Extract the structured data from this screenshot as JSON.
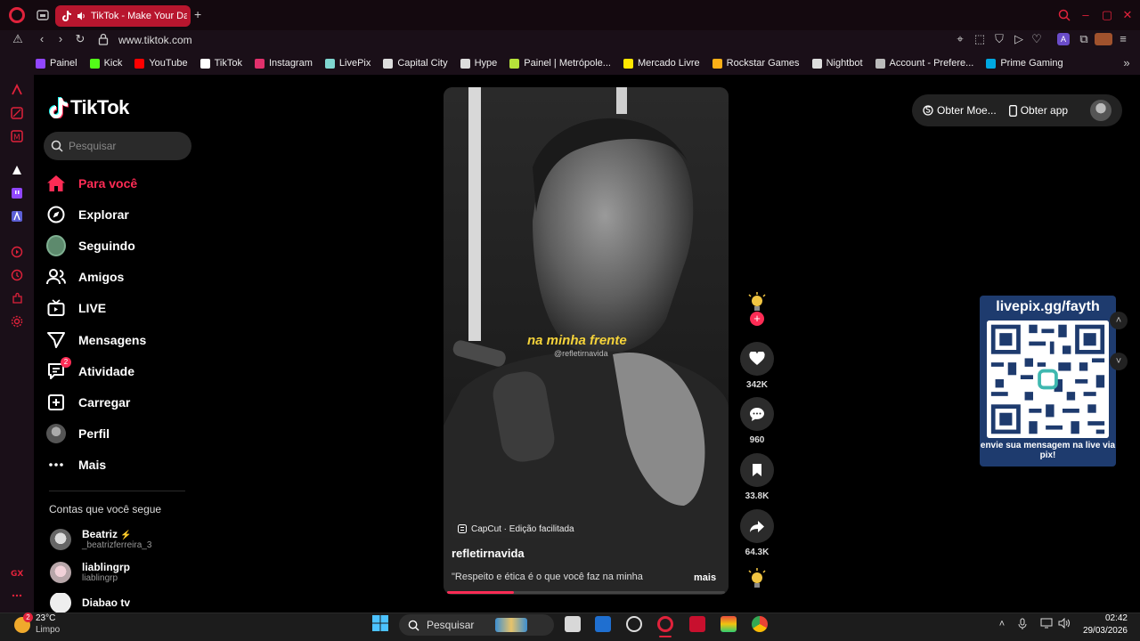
{
  "browser": {
    "tab_title": "TikTok - Make Your Day",
    "url": "www.tiktok.com",
    "bookmarks": [
      {
        "label": "Painel",
        "color": "#9146ff"
      },
      {
        "label": "Kick",
        "color": "#53fc18"
      },
      {
        "label": "YouTube",
        "color": "#ff0000"
      },
      {
        "label": "TikTok",
        "color": "#ffffff"
      },
      {
        "label": "Instagram",
        "color": "#e1306c"
      },
      {
        "label": "LivePix",
        "color": "#7fd6d0"
      },
      {
        "label": "Capital City",
        "color": "#dddddd"
      },
      {
        "label": "Hype",
        "color": "#dddddd"
      },
      {
        "label": "Painel | Metrópole...",
        "color": "#b6e23a"
      },
      {
        "label": "Mercado Livre",
        "color": "#ffe600"
      },
      {
        "label": "Rockstar Games",
        "color": "#fcaf17"
      },
      {
        "label": "Nightbot",
        "color": "#dddddd"
      },
      {
        "label": "Account - Prefere...",
        "color": "#bbbbbb"
      },
      {
        "label": "Prime Gaming",
        "color": "#00a8e1"
      }
    ]
  },
  "tiktok": {
    "logo_text": "TikTok",
    "search_placeholder": "Pesquisar",
    "nav": [
      {
        "label": "Para você",
        "icon": "home-icon"
      },
      {
        "label": "Explorar",
        "icon": "compass-icon"
      },
      {
        "label": "Seguindo",
        "icon": "following-avatar-icon"
      },
      {
        "label": "Amigos",
        "icon": "friends-icon"
      },
      {
        "label": "LIVE",
        "icon": "live-icon"
      },
      {
        "label": "Mensagens",
        "icon": "messages-icon"
      },
      {
        "label": "Atividade",
        "icon": "activity-icon",
        "badge": "2"
      },
      {
        "label": "Carregar",
        "icon": "upload-icon"
      },
      {
        "label": "Perfil",
        "icon": "profile-avatar-icon"
      },
      {
        "label": "Mais",
        "icon": "more-icon"
      }
    ],
    "following_title": "Contas que você segue",
    "following": [
      {
        "name": "Beatriz",
        "username": "_beatrizferreira_3"
      },
      {
        "name": "liablingrp",
        "username": "liablingrp"
      },
      {
        "name": "Diabao tv",
        "username": ""
      }
    ],
    "top_actions": {
      "coins": "Obter Moe...",
      "app": "Obter app"
    },
    "video": {
      "caption_overlay": "na minha frente",
      "watermark": "@refletirnavida",
      "capcut_tag": "CapCut · Edição facilitada",
      "author": "refletirnavida",
      "description": "\"Respeito e ética é o que você faz na minha",
      "more_label": "mais",
      "progress": 0.24
    },
    "actions": {
      "likes": "342K",
      "comments": "960",
      "saves": "33.8K",
      "shares": "64.3K"
    }
  },
  "livepix": {
    "title": "livepix.gg/fayth",
    "footer": "envie sua mensagem na live via pix!"
  },
  "taskbar": {
    "temp": "23°C",
    "weather": "Limpo",
    "weather_badge": "2",
    "search_placeholder": "Pesquisar",
    "time": "02:42",
    "date": "29/03/2026"
  }
}
